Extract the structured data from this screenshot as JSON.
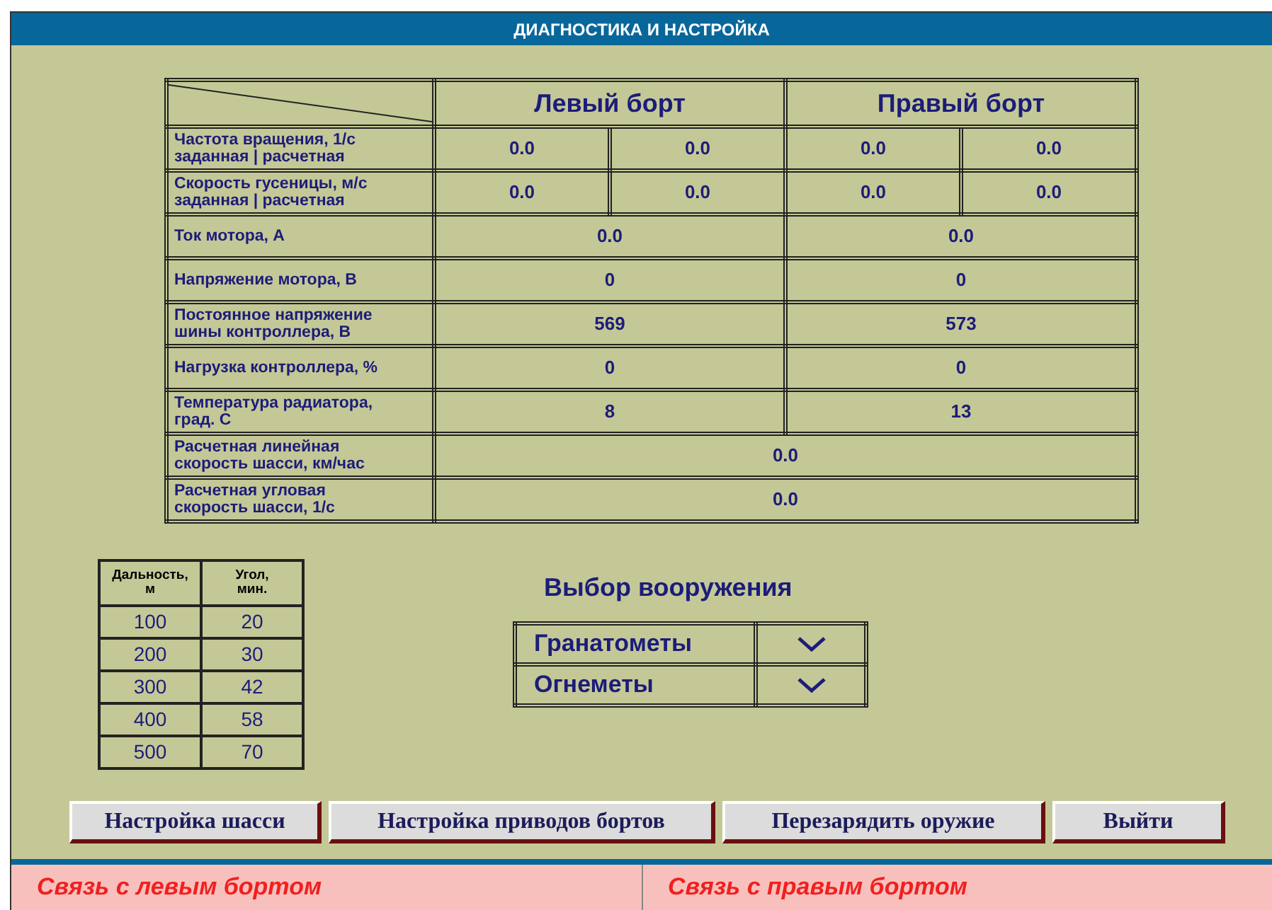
{
  "window": {
    "title": "ДИАГНОСТИКА И НАСТРОЙКА"
  },
  "diagnostics": {
    "columns": [
      "Левый борт",
      "Правый борт"
    ],
    "rows": [
      {
        "kind": "split",
        "label": [
          "Частота вращения, 1/с",
          "заданная | расчетная"
        ],
        "values": [
          "0.0",
          "0.0",
          "0.0",
          "0.0"
        ]
      },
      {
        "kind": "split",
        "label": [
          "Скорость гусеницы, м/с",
          "заданная | расчетная"
        ],
        "values": [
          "0.0",
          "0.0",
          "0.0",
          "0.0"
        ]
      },
      {
        "kind": "pair",
        "label": [
          "Ток мотора, А"
        ],
        "values": [
          "0.0",
          "0.0"
        ]
      },
      {
        "kind": "pair",
        "label": [
          "Напряжение мотора, В"
        ],
        "values": [
          "0",
          "0"
        ]
      },
      {
        "kind": "pair",
        "label": [
          "Постоянное напряжение",
          "шины контроллера, В"
        ],
        "values": [
          "569",
          "573"
        ]
      },
      {
        "kind": "pair",
        "label": [
          "Нагрузка контроллера, %"
        ],
        "values": [
          "0",
          "0"
        ]
      },
      {
        "kind": "pair",
        "label": [
          "Температура радиатора,",
          "град. С"
        ],
        "values": [
          "8",
          "13"
        ]
      },
      {
        "kind": "single",
        "label": [
          "Расчетная линейная",
          "скорость шасси, км/час"
        ],
        "values": [
          "0.0"
        ]
      },
      {
        "kind": "single",
        "label": [
          "Расчетная угловая",
          "скорость шасси, 1/с"
        ],
        "values": [
          "0.0"
        ]
      }
    ]
  },
  "range_table": {
    "columns": [
      "Дальность,\nм",
      "Угол,\nмин."
    ],
    "rows": [
      [
        "100",
        "20"
      ],
      [
        "200",
        "30"
      ],
      [
        "300",
        "42"
      ],
      [
        "400",
        "58"
      ],
      [
        "500",
        "70"
      ]
    ]
  },
  "weapons": {
    "title": "Выбор вооружения",
    "items": [
      "Гранатометы",
      "Огнеметы"
    ]
  },
  "buttons": [
    "Настройка шасси",
    "Настройка приводов бортов",
    "Перезарядить оружие",
    "Выйти"
  ],
  "status_bar": [
    "Связь с левым бортом",
    "Связь с правым бортом"
  ]
}
